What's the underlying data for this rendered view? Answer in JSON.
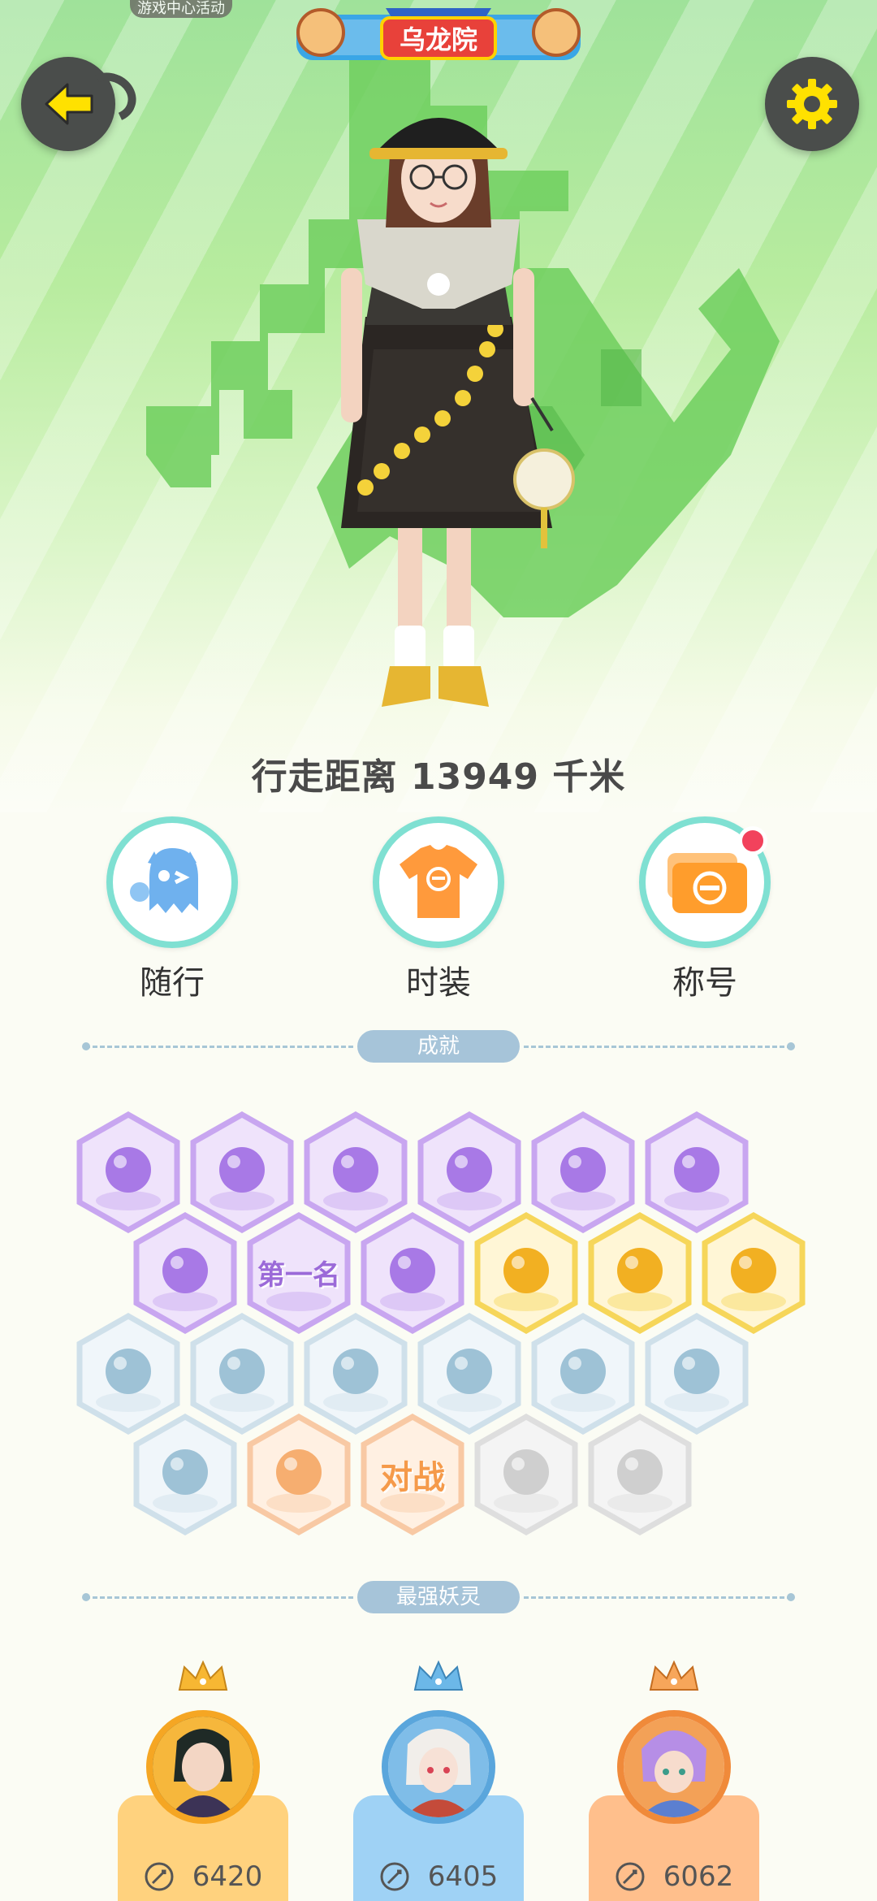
{
  "header": {
    "top_banner": "游戏中心活动",
    "logo_text": "乌龙院"
  },
  "profile": {
    "distance_text": "行走距离 13949 千米"
  },
  "menu": [
    {
      "label": "随行",
      "icon": "ghost-pet-icon"
    },
    {
      "label": "时装",
      "icon": "tshirt-icon"
    },
    {
      "label": "称号",
      "icon": "title-card-icon",
      "has_notification": true
    }
  ],
  "sections": {
    "achievements_title": "成就",
    "strongest_title": "最强妖灵"
  },
  "achievements": {
    "text_badges": {
      "first_place": "第一名",
      "battle": "对战"
    }
  },
  "spirits": [
    {
      "score": "6420",
      "theme": "#ffd27e"
    },
    {
      "score": "6405",
      "theme": "#9fd2f5"
    },
    {
      "score": "6062",
      "theme": "#ffbf8c"
    }
  ],
  "colors": {
    "accent_yellow": "#ffe100",
    "teal_ring": "#7fe0d2",
    "badge_purple": "#c8a6f0",
    "badge_gold": "#f6d65a",
    "badge_blue": "#cfe0ea",
    "badge_orange": "#f8c9a4",
    "badge_gray": "#dedede",
    "notification_red": "#f2425c"
  }
}
